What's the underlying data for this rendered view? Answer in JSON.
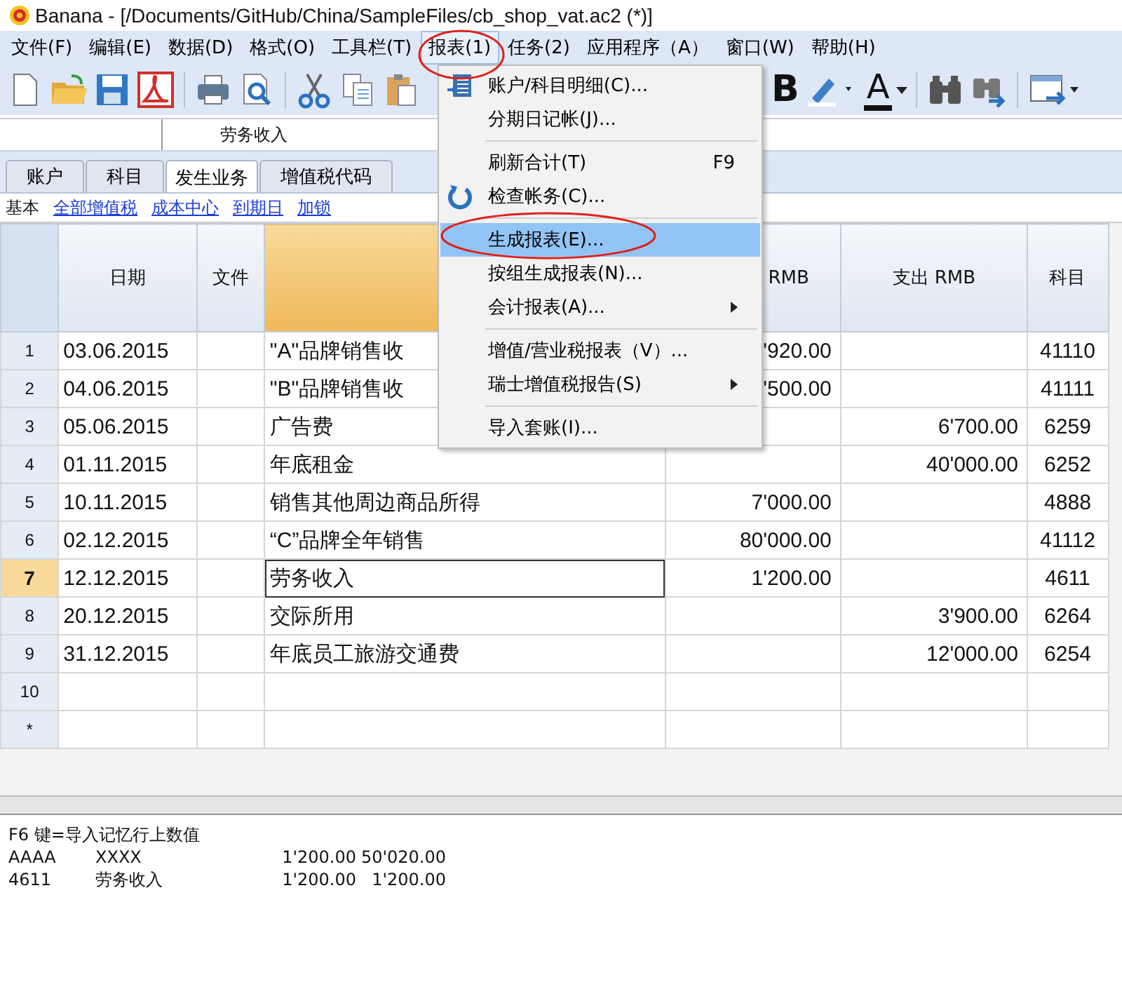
{
  "window": {
    "title": "Banana - [/Documents/GitHub/China/SampleFiles/cb_shop_vat.ac2 (*)]"
  },
  "menu_bar": [
    {
      "label": "文件(F)",
      "selected": false
    },
    {
      "label": "编辑(E)",
      "selected": false
    },
    {
      "label": "数据(D)",
      "selected": false
    },
    {
      "label": "格式(O)",
      "selected": false
    },
    {
      "label": "工具栏(T)",
      "selected": false
    },
    {
      "label": "报表(1)",
      "selected": true
    },
    {
      "label": "任务(2)",
      "selected": false
    },
    {
      "label": "应用程序（A）",
      "selected": false
    },
    {
      "label": "窗口(W)",
      "selected": false
    },
    {
      "label": "帮助(H)",
      "selected": false
    }
  ],
  "toolbar_right": {
    "bold": "B",
    "font_color": "A"
  },
  "input_bar": {
    "value": "劳务收入"
  },
  "tabs": [
    {
      "label": "账户",
      "selected": false
    },
    {
      "label": "科目",
      "selected": false
    },
    {
      "label": "发生业务",
      "selected": true
    },
    {
      "label": "增值税代码",
      "selected": false
    }
  ],
  "views": [
    {
      "label": "基本",
      "selected": true
    },
    {
      "label": "全部增值税",
      "selected": false
    },
    {
      "label": "成本中心",
      "selected": false
    },
    {
      "label": "到期日",
      "selected": false
    },
    {
      "label": "加锁",
      "selected": false
    }
  ],
  "table": {
    "columns": [
      "日期",
      "文件",
      "",
      "RMB",
      "支出 RMB",
      "科目"
    ],
    "rows": [
      {
        "num": "1",
        "date": "03.06.2015",
        "description": "\"A\"品牌销售收",
        "income": "'920.00",
        "expense": "",
        "account": "41110",
        "selected": false
      },
      {
        "num": "2",
        "date": "04.06.2015",
        "description": "\"B\"品牌销售收",
        "income": "'500.00",
        "expense": "",
        "account": "41111",
        "selected": false
      },
      {
        "num": "3",
        "date": "05.06.2015",
        "description": "广告费",
        "income": "",
        "expense": "6'700.00",
        "account": "6259",
        "selected": false
      },
      {
        "num": "4",
        "date": "01.11.2015",
        "description": "年底租金",
        "income": "",
        "expense": "40'000.00",
        "account": "6252",
        "selected": false
      },
      {
        "num": "5",
        "date": "10.11.2015",
        "description": "销售其他周边商品所得",
        "income": "7'000.00",
        "expense": "",
        "account": "4888",
        "selected": false
      },
      {
        "num": "6",
        "date": "02.12.2015",
        "description": "“C”品牌全年销售",
        "income": "80'000.00",
        "expense": "",
        "account": "41112",
        "selected": false
      },
      {
        "num": "7",
        "date": "12.12.2015",
        "description": "劳务收入",
        "income": "1'200.00",
        "expense": "",
        "account": "4611",
        "selected": true
      },
      {
        "num": "8",
        "date": "20.12.2015",
        "description": "交际所用",
        "income": "",
        "expense": "3'900.00",
        "account": "6264",
        "selected": false
      },
      {
        "num": "9",
        "date": "31.12.2015",
        "description": "年底员工旅游交通费",
        "income": "",
        "expense": "12'000.00",
        "account": "6254",
        "selected": false
      },
      {
        "num": "10",
        "date": "",
        "description": "",
        "income": "",
        "expense": "",
        "account": "",
        "selected": false
      },
      {
        "num": "*",
        "date": "",
        "description": "",
        "income": "",
        "expense": "",
        "account": "",
        "selected": false
      }
    ]
  },
  "dropdown_menu": [
    {
      "kind": "item",
      "label": "账户/科目明细(C)...",
      "selected": false
    },
    {
      "kind": "item",
      "label": "分期日记帐(J)...",
      "selected": false
    },
    {
      "kind": "separator"
    },
    {
      "kind": "item",
      "label": "刷新合计(T)",
      "shortcut": "F9",
      "selected": false
    },
    {
      "kind": "item",
      "label": "检查帐务(C)...",
      "selected": false
    },
    {
      "kind": "separator"
    },
    {
      "kind": "item",
      "label": "生成报表(E)...",
      "selected": true
    },
    {
      "kind": "item",
      "label": "按组生成报表(N)...",
      "selected": false
    },
    {
      "kind": "item",
      "label": "会计报表(A)...",
      "submenu": true,
      "selected": false
    },
    {
      "kind": "separator"
    },
    {
      "kind": "item",
      "label": "增值/营业税报表（V）...",
      "selected": false
    },
    {
      "kind": "item",
      "label": "瑞士增值税报告(S)",
      "submenu": true,
      "selected": false
    },
    {
      "kind": "separator"
    },
    {
      "kind": "item",
      "label": "导入套账(I)...",
      "selected": false
    }
  ],
  "info_panel": {
    "hint": "F6 键=导入记忆行上数值",
    "lines": [
      {
        "code": "AAAA",
        "name": "XXXX",
        "amount": "1'200.00",
        "balance": "50'020.00"
      },
      {
        "code": "4611",
        "name": "劳务收入",
        "amount": "1'200.00",
        "balance": "1'200.00"
      }
    ]
  }
}
